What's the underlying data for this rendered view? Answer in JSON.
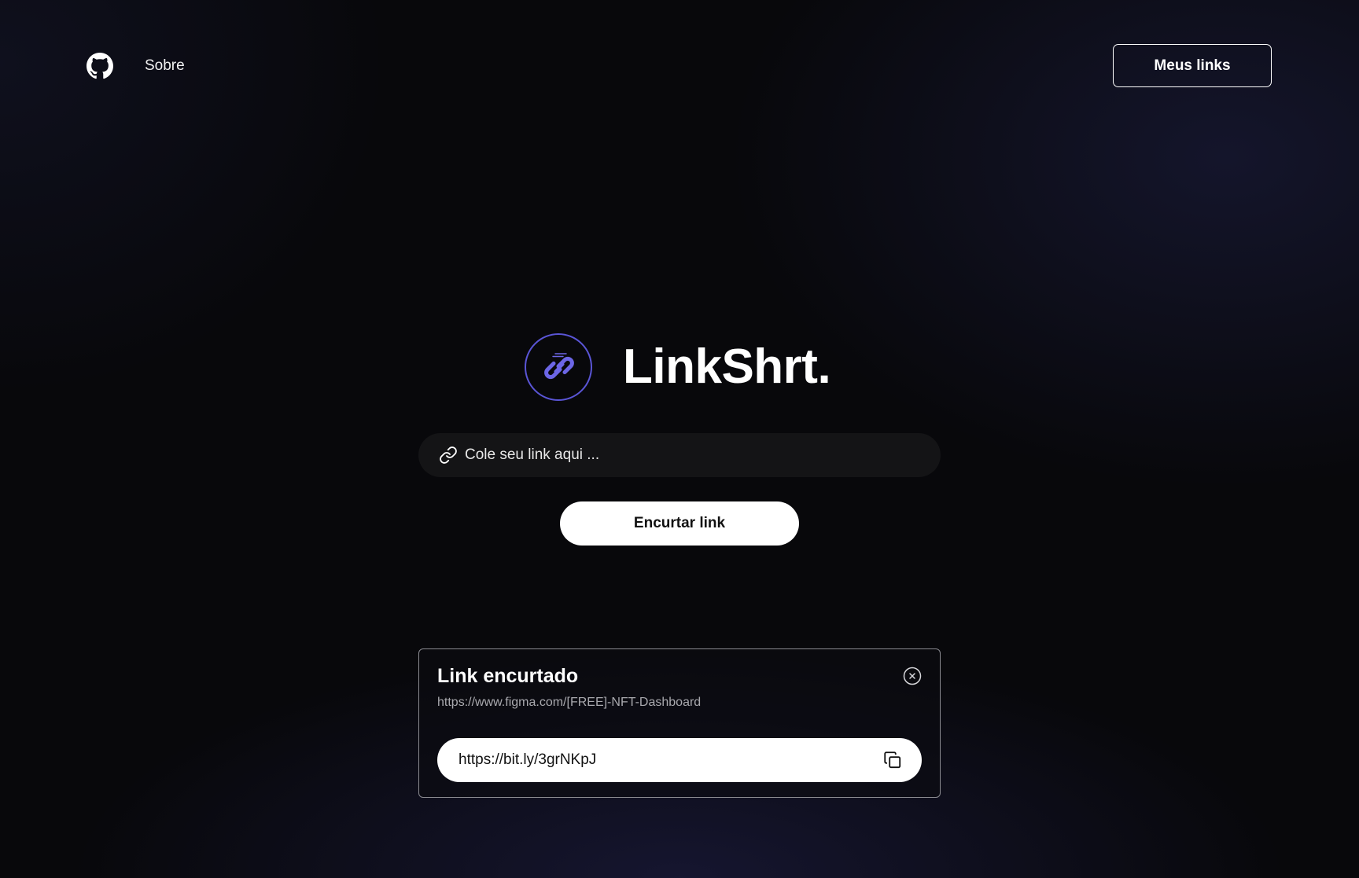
{
  "header": {
    "github_icon": "github-icon",
    "nav_about": "Sobre",
    "my_links_button": "Meus links"
  },
  "brand": {
    "logo_icon": "chain-link-icon",
    "name": "LinkShrt.",
    "accent_color": "#5a55d6"
  },
  "shortener": {
    "input_icon": "link-icon",
    "input_placeholder": "Cole seu link aqui ...",
    "input_value": "",
    "submit_button": "Encurtar link"
  },
  "result": {
    "title": "Link encurtado",
    "original_url": "https://www.figma.com/[FREE]-NFT-Dashboard",
    "short_url": "https://bit.ly/3grNKpJ",
    "close_icon": "close-circle-icon",
    "copy_icon": "copy-icon"
  }
}
